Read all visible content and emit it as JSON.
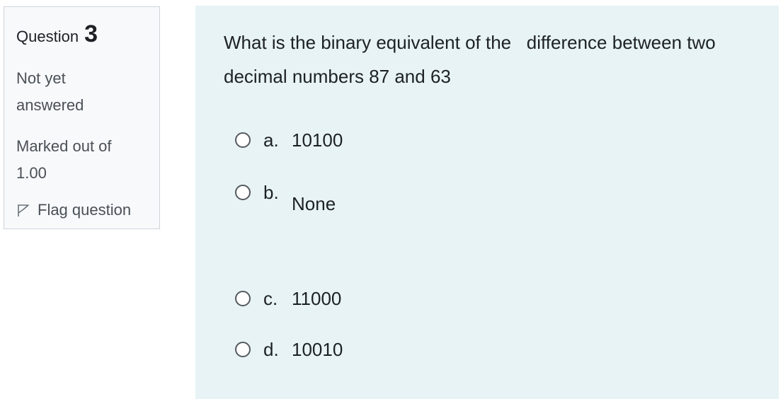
{
  "info": {
    "question_label": "Question",
    "question_number": "3",
    "state": "Not yet answered",
    "grade": "Marked out of 1.00",
    "flag_label": "Flag question"
  },
  "question": {
    "text": "What is the binary equivalent of the   difference between two decimal numbers 87 and 63",
    "options": [
      {
        "letter": "a.",
        "value": "10100"
      },
      {
        "letter": "b.",
        "value": "None"
      },
      {
        "letter": "c.",
        "value": "11000"
      },
      {
        "letter": "d.",
        "value": "10010"
      }
    ]
  }
}
